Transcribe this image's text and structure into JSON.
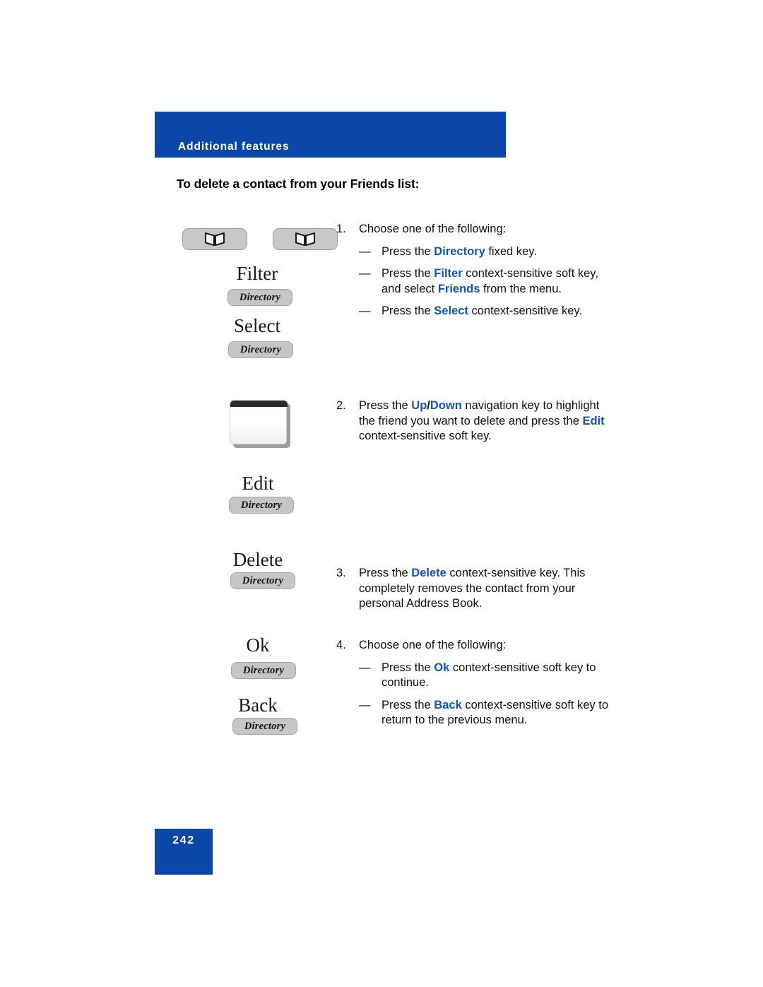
{
  "header": {
    "band_label": "Additional features",
    "band_color": "#0b47a8"
  },
  "section": {
    "title": "To delete a contact from your Friends list:"
  },
  "colors": {
    "banner_blue": "#0b47a8",
    "emphasis_blue": "#1154bd",
    "key_gray": "#c6c6c6",
    "text_black": "#111111"
  },
  "graphics": {
    "fixed_keys": [
      {
        "icon": "open-book-icon",
        "label": "Directory fixed key"
      },
      {
        "icon": "open-book-icon",
        "label": "Directory fixed key"
      }
    ],
    "soft_keys": [
      {
        "title": "Filter",
        "button_label": "Directory"
      },
      {
        "title": "Select",
        "button_label": "Directory"
      },
      {
        "title": "Edit",
        "button_label": "Directory"
      },
      {
        "title": "Delete",
        "button_label": "Directory"
      },
      {
        "title": "Ok",
        "button_label": "Directory"
      },
      {
        "title": "Back",
        "button_label": "Directory"
      }
    ],
    "navigation_key": {
      "name": "up-down-navigation-key"
    }
  },
  "steps": [
    {
      "number": "1.",
      "text": "Choose one of the following:",
      "bullets": [
        {
          "dash": "—",
          "parts": [
            {
              "t": "Press the ",
              "style": "plain"
            },
            {
              "t": "Directory",
              "style": "key"
            },
            {
              "t": " fixed key.",
              "style": "plain"
            }
          ]
        },
        {
          "dash": "—",
          "parts": [
            {
              "t": "Press the ",
              "style": "plain"
            },
            {
              "t": "Filter",
              "style": "key"
            },
            {
              "t": " context-sensitive soft key, and select ",
              "style": "plain"
            },
            {
              "t": "Friends",
              "style": "key"
            },
            {
              "t": " from the menu.",
              "style": "plain"
            }
          ]
        },
        {
          "dash": "—",
          "parts": [
            {
              "t": "Press the ",
              "style": "plain"
            },
            {
              "t": "Select",
              "style": "key"
            },
            {
              "t": " context-sensitive key.",
              "style": "plain"
            }
          ]
        }
      ]
    },
    {
      "number": "2.",
      "parts": [
        {
          "t": "Press the ",
          "style": "plain"
        },
        {
          "t": "Up",
          "style": "key"
        },
        {
          "t": "/",
          "style": "sep"
        },
        {
          "t": "Down",
          "style": "key"
        },
        {
          "t": " navigation key to highlight the friend you want to delete and press the ",
          "style": "plain"
        },
        {
          "t": "Edit",
          "style": "key"
        },
        {
          "t": " context-sensitive soft key.",
          "style": "plain"
        }
      ],
      "bullets": []
    },
    {
      "number": "3.",
      "parts": [
        {
          "t": "Press the ",
          "style": "plain"
        },
        {
          "t": "Delete",
          "style": "key"
        },
        {
          "t": " context-sensitive key. This completely removes the contact from your personal Address Book.",
          "style": "plain"
        }
      ],
      "bullets": []
    },
    {
      "number": "4.",
      "text": "Choose one of the following:",
      "bullets": [
        {
          "dash": "—",
          "parts": [
            {
              "t": "Press the ",
              "style": "plain"
            },
            {
              "t": "Ok",
              "style": "key"
            },
            {
              "t": " context-sensitive soft key to continue.",
              "style": "plain"
            }
          ]
        },
        {
          "dash": "—",
          "parts": [
            {
              "t": "Press the ",
              "style": "plain"
            },
            {
              "t": "Back",
              "style": "key"
            },
            {
              "t": " context-sensitive soft key to return to the previous menu.",
              "style": "plain"
            }
          ]
        }
      ]
    }
  ],
  "footer": {
    "page_number": "242"
  }
}
